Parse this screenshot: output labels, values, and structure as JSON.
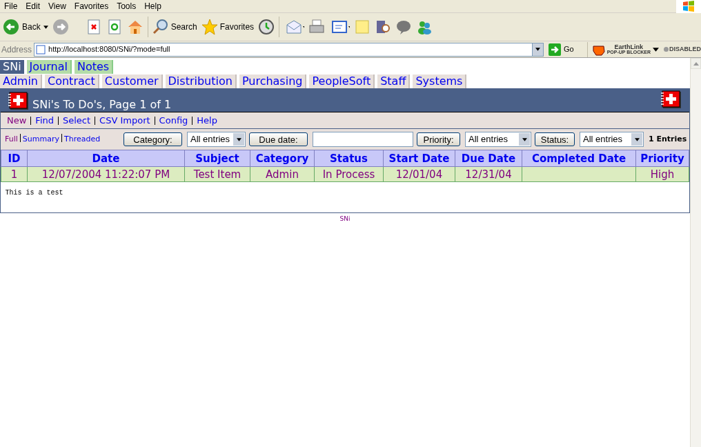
{
  "menu": [
    "File",
    "Edit",
    "View",
    "Favorites",
    "Tools",
    "Help"
  ],
  "toolbar": {
    "back": "Back",
    "search": "Search",
    "favorites": "Favorites"
  },
  "address": {
    "label": "Address",
    "url": "http://localhost:8080/SNi/?mode=full",
    "go": "Go"
  },
  "popup_blocker": {
    "brand": "EarthLink",
    "subtitle": "POP-UP BLOCKER",
    "status": "DISABLED"
  },
  "app_tabs": [
    {
      "label": "SNi",
      "selected": true
    },
    {
      "label": "Journal",
      "selected": false
    },
    {
      "label": "Notes",
      "selected": false
    }
  ],
  "module_tabs": [
    "Admin",
    "Contract",
    "Customer",
    "Distribution",
    "Purchasing",
    "PeopleSoft",
    "Staff",
    "Systems"
  ],
  "page_title": "SNi's To Do's, Page 1 of 1",
  "actions": [
    {
      "label": "New",
      "visited": true
    },
    {
      "label": "Find",
      "visited": false
    },
    {
      "label": "Select",
      "visited": false
    },
    {
      "label": "CSV Import",
      "visited": false
    },
    {
      "label": "Config",
      "visited": false
    },
    {
      "label": "Help",
      "visited": false
    }
  ],
  "views": [
    {
      "label": "Full",
      "visited": true
    },
    {
      "label": "Summary",
      "visited": false
    },
    {
      "label": "Threaded",
      "visited": false
    }
  ],
  "filters": [
    {
      "kind": "select",
      "button": "Category:",
      "value": "All entries"
    },
    {
      "kind": "text",
      "button": "Due date:"
    },
    {
      "kind": "select",
      "button": "Priority:",
      "value": "All entries"
    },
    {
      "kind": "select",
      "button": "Status:",
      "value": "All entries"
    }
  ],
  "entries_count": "1 Entries",
  "table": {
    "columns": [
      "ID",
      "Date",
      "Subject",
      "Category",
      "Status",
      "Start Date",
      "Due Date",
      "Completed Date",
      "Priority"
    ],
    "rows": [
      {
        "cells": [
          "1",
          "12/07/2004 11:22:07 PM",
          "Test Item",
          "Admin",
          "In Process",
          "12/01/04",
          "12/31/04",
          "",
          "High"
        ],
        "note": "This is a test"
      }
    ]
  },
  "footer": "SNi"
}
